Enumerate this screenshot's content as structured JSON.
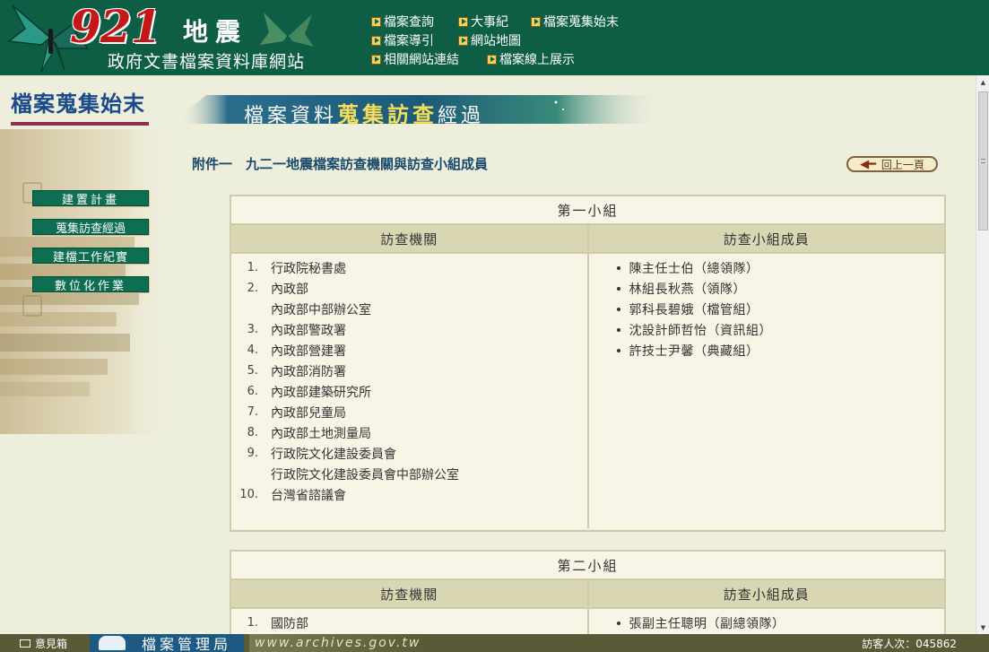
{
  "header": {
    "logo_number": "921",
    "logo_title": "地震",
    "logo_subtitle": "政府文書檔案資料庫網站",
    "nav": [
      {
        "label": "檔案查詢"
      },
      {
        "label": "大事紀"
      },
      {
        "label": "檔案蒐集始末"
      },
      {
        "label": "檔案導引"
      },
      {
        "label": "網站地圖"
      },
      {
        "label": "相關網站連結"
      },
      {
        "label": "檔案線上展示"
      }
    ]
  },
  "sidebar": {
    "title": "檔案蒐集始末",
    "items": [
      {
        "label": "建置計畫"
      },
      {
        "label": "蒐集訪查經過"
      },
      {
        "label": "建檔工作紀實"
      },
      {
        "label": "數位化作業"
      }
    ]
  },
  "main": {
    "banner_prefix": "檔案資料",
    "banner_highlight": "蒐集訪查",
    "banner_suffix": "經過",
    "subtitle": "附件一　九二一地震檔案訪查機關與訪查小組成員",
    "back_label": "回上一頁",
    "groups": [
      {
        "title": "第一小組",
        "col_org": "訪查機關",
        "col_members": "訪查小組成員",
        "orgs": [
          {
            "num": "1.",
            "name": "行政院秘書處"
          },
          {
            "num": "2.",
            "name": "內政部"
          },
          {
            "num": "",
            "name": "內政部中部辦公室"
          },
          {
            "num": "3.",
            "name": "內政部警政署"
          },
          {
            "num": "4.",
            "name": "內政部營建署"
          },
          {
            "num": "5.",
            "name": "內政部消防署"
          },
          {
            "num": "6.",
            "name": "內政部建築研究所"
          },
          {
            "num": "7.",
            "name": "內政部兒童局"
          },
          {
            "num": "8.",
            "name": "內政部土地測量局"
          },
          {
            "num": "9.",
            "name": "行政院文化建設委員會"
          },
          {
            "num": "",
            "name": "行政院文化建設委員會中部辦公室"
          },
          {
            "num": "10.",
            "name": "台灣省諮議會"
          }
        ],
        "members": [
          "陳主任士伯（總領隊）",
          "林組長秋燕（領隊）",
          "郭科長碧娥（檔管組）",
          "沈設計師哲怡（資訊組）",
          "許技士尹馨（典藏組）"
        ]
      },
      {
        "title": "第二小組",
        "col_org": "訪查機關",
        "col_members": "訪查小組成員",
        "orgs": [
          {
            "num": "1.",
            "name": "國防部"
          }
        ],
        "members": [
          "張副主任聰明（副總領隊）"
        ]
      }
    ]
  },
  "footer": {
    "feedback_label": "意見箱",
    "agency_label": "檔案管理局",
    "url_label": "www.archives.gov.tw",
    "visitor_label": "訪客人次：045862"
  },
  "colors": {
    "header_bg": "#0d5e45",
    "sidebar_button": "#0e6e52",
    "table_header": "#d9d6b4",
    "page_bg": "#eeeedd",
    "footer_bg": "#5a5a38"
  }
}
